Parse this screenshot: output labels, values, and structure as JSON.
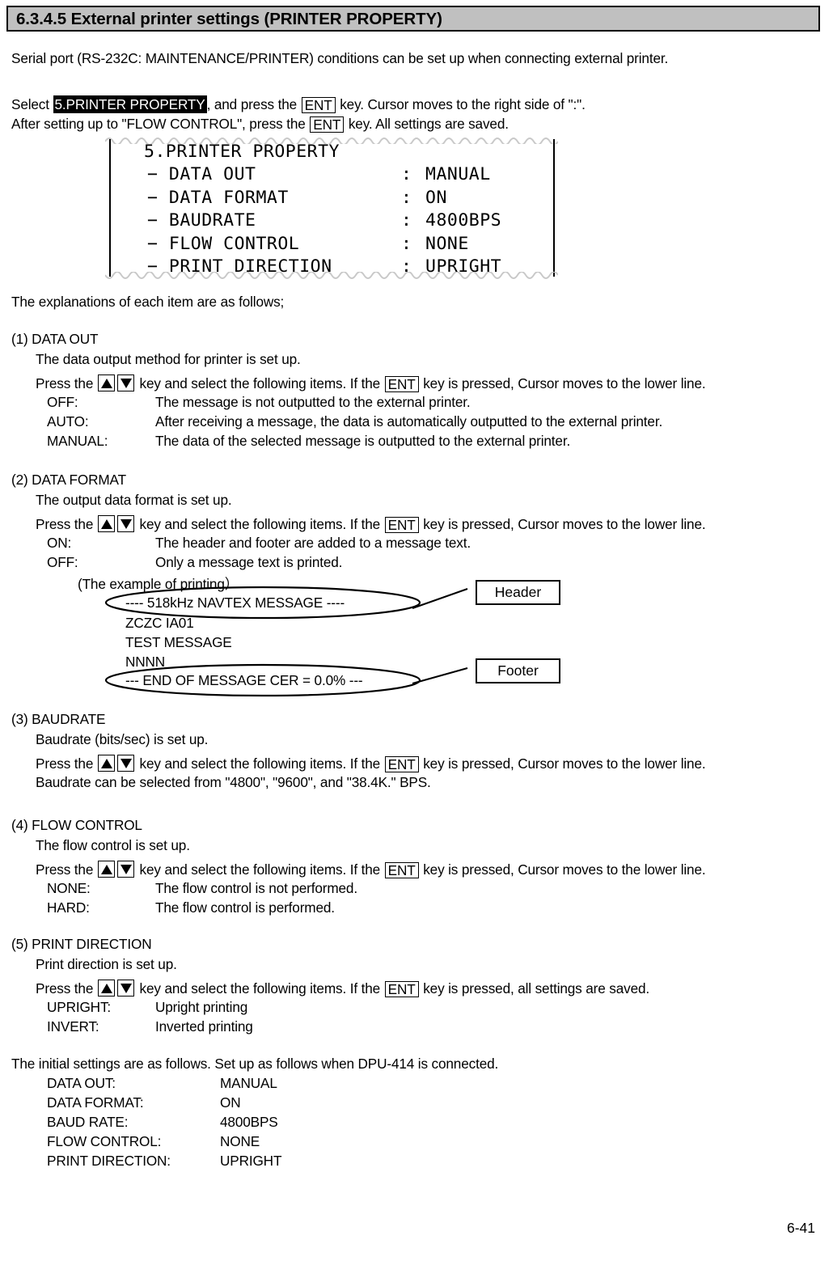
{
  "header": {
    "title": "6.3.4.5 External printer settings (PRINTER PROPERTY)",
    "background": "#c0c0c0"
  },
  "intro": {
    "line1": "Serial port (RS-232C: MAINTENANCE/PRINTER) conditions can be set up when connecting external printer.",
    "select_prefix": "Select ",
    "select_highlight": "5.PRINTER PROPERTY",
    "select_suffix_a": ", and press the ",
    "ent_key": "ENT",
    "select_suffix_b": " key. Cursor moves to the right side of \":\".",
    "line3_prefix": "After setting up to \"FLOW CONTROL\", press the ",
    "line3_suffix": " key. All settings are saved."
  },
  "lcd": {
    "title": "5.PRINTER PROPERTY",
    "title_dot": "5.",
    "title_text": "PRINTER PROPERTY",
    "dash": "−",
    "colon": ":",
    "rows": [
      {
        "label": "DATA OUT",
        "value": "MANUAL"
      },
      {
        "label": "DATA FORMAT",
        "value": "ON"
      },
      {
        "label": "BAUDRATE",
        "value": "4800BPS"
      },
      {
        "label": "FLOW CONTROL",
        "value": "NONE"
      },
      {
        "label": "PRINT DIRECTION",
        "value": "UPRIGHT"
      }
    ]
  },
  "explain_lead": "The explanations of each item are as follows;",
  "press_key_sentence": {
    "prefix": "Press the ",
    "middle": " key and select the following items. If the ",
    "ent": "ENT",
    "suffix_lower": " key is pressed, Cursor moves to the lower line.",
    "suffix_saved": " key is pressed, all settings are saved."
  },
  "sections": [
    {
      "heading": "(1) DATA OUT",
      "sub": "The data output method for printer is set up.",
      "items": [
        {
          "term": "OFF:",
          "desc": "The message is not outputted to the external printer."
        },
        {
          "term": "AUTO:",
          "desc": "After receiving a message, the data is automatically outputted to the external printer."
        },
        {
          "term": "MANUAL:",
          "desc": "The data of the selected message is outputted to the external printer."
        }
      ]
    },
    {
      "heading": "(2) DATA FORMAT",
      "sub": "The output data format is set up.",
      "items": [
        {
          "term": "ON:",
          "desc": "The header and footer are added to a message text."
        },
        {
          "term": "OFF:",
          "desc": "Only a message text is printed."
        }
      ]
    },
    {
      "heading": "(3) BAUDRATE",
      "sub": "Baudrate (bits/sec) is set up.",
      "extra": "Baudrate can be selected from \"4800\", \"9600\", and \"38.4K.\" BPS."
    },
    {
      "heading": "(4) FLOW CONTROL",
      "sub": "The flow control is set up.",
      "items": [
        {
          "term": "NONE:",
          "desc": "The flow control is not performed."
        },
        {
          "term": "HARD:",
          "desc": "The flow control is performed."
        }
      ]
    },
    {
      "heading": "(5) PRINT DIRECTION",
      "sub": "Print direction is set up.",
      "items": [
        {
          "term": "UPRIGHT:",
          "desc": "Upright printing"
        },
        {
          "term": "INVERT:",
          "desc": "Inverted printing"
        }
      ]
    }
  ],
  "print_example": {
    "caption": "(The example of printing）",
    "header_line": "---- 518kHz NAVTEX MESSAGE      ----",
    "body_lines": [
      "ZCZC IA01",
      "TEST MESSAGE",
      "NNNN"
    ],
    "footer_line": "--- END OF MESSAGE CER = 0.0% ---",
    "header_callout": "Header",
    "footer_callout": "Footer"
  },
  "initial_settings": {
    "lead": "The initial settings are as follows. Set up as follows when DPU-414 is connected.",
    "rows": [
      {
        "name": "DATA OUT:",
        "value": "MANUAL"
      },
      {
        "name": "DATA FORMAT:",
        "value": "ON"
      },
      {
        "name": "BAUD RATE:",
        "value": "4800BPS"
      },
      {
        "name": "FLOW CONTROL:",
        "value": "NONE"
      },
      {
        "name": "PRINT DIRECTION:",
        "value": "UPRIGHT"
      }
    ]
  },
  "page_number": "6-41"
}
